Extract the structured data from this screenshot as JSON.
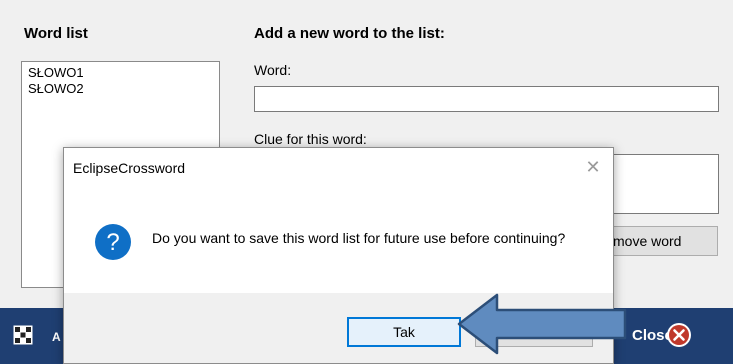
{
  "window": {
    "word_list_title": "Word list",
    "add_word_title": "Add a new word to the list:",
    "word_label": "Word:",
    "word_value": "",
    "clue_label": "Clue for this word:",
    "clue_value": "",
    "words": [
      "SŁOWO1",
      "SŁOWO2"
    ],
    "remove_button_label": "move word",
    "bottom_bar": {
      "left_letter": "A",
      "close_label": "Close"
    }
  },
  "dialog": {
    "title": "EclipseCrossword",
    "close_glyph": "✕",
    "message": "Do you want to save this word list for future use before continuing?",
    "icon": "question-icon",
    "buttons": {
      "yes_label": "Tak"
    }
  },
  "colors": {
    "bottom_bar": "#1f3f72",
    "question_icon": "#0f6fc6",
    "close_icon": "#c0392b",
    "arrow_fill": "#5f8bbf",
    "arrow_stroke": "#2c4e78",
    "focus_border": "#0078d7"
  }
}
